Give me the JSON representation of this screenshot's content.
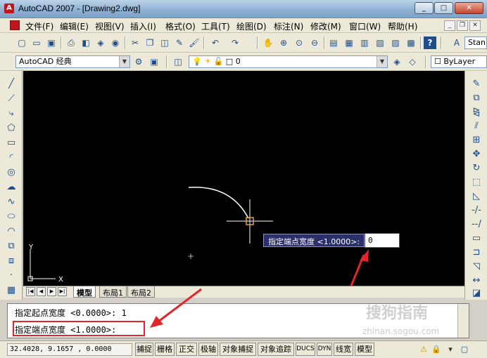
{
  "window": {
    "app_icon": "A",
    "title": "AutoCAD 2007 - [Drawing2.dwg]",
    "min": "_",
    "max": "□",
    "close": "✕"
  },
  "menu": {
    "items": [
      "文件(F)",
      "编辑(E)",
      "视图(V)",
      "插入(I)",
      "格式(O)",
      "工具(T)",
      "绘图(D)",
      "标注(N)",
      "修改(M)",
      "窗口(W)",
      "帮助(H)"
    ],
    "mdi_min": "_",
    "mdi_restore": "❐",
    "mdi_close": "✕"
  },
  "toolbar": {
    "workspace": "AutoCAD 经典",
    "layer": "0",
    "text_style": "Stan",
    "bylayer": "ByLayer"
  },
  "icons": {
    "toolbar1": [
      "new-icon",
      "open-icon",
      "save-icon",
      "print-icon",
      "preview-icon",
      "publish-icon",
      "3d-publish-icon",
      "cut-icon",
      "copy-icon",
      "paste-icon",
      "match-prop-icon",
      "brush-icon",
      "undo-icon",
      "redo-icon",
      "pan-icon",
      "zoom-realtime-icon",
      "zoom-window-icon",
      "zoom-previous-icon",
      "properties-icon",
      "design-center-icon",
      "tool-palette-icon",
      "sheet-set-icon",
      "markup-icon",
      "calculator-icon",
      "help-icon",
      "text-style-icon"
    ],
    "left": [
      "line-icon",
      "construction-line-icon",
      "polyline-icon",
      "polygon-icon",
      "rectangle-icon",
      "arc-icon",
      "circle-icon",
      "revision-cloud-icon",
      "spline-icon",
      "ellipse-icon",
      "ellipse-arc-icon",
      "insert-block-icon",
      "make-block-icon",
      "point-icon",
      "hatch-icon"
    ],
    "right": [
      "erase-icon",
      "copy-object-icon",
      "mirror-icon",
      "offset-icon",
      "array-icon",
      "move-icon",
      "rotate-icon",
      "scale-icon",
      "stretch-icon",
      "trim-icon",
      "extend-icon",
      "break-icon",
      "join-icon",
      "chamfer-icon",
      "fillet-icon",
      "explode-icon"
    ]
  },
  "drawing": {
    "axis_y": "Y",
    "axis_x": "X",
    "dyn_prompt": "指定端点宽度 <1.0000>:",
    "dyn_value": "0"
  },
  "tabs": {
    "nav": [
      "|◀",
      "◀",
      "▶",
      "▶|"
    ],
    "items": [
      "模型",
      "布局1",
      "布局2"
    ]
  },
  "command": {
    "line1": "指定起点宽度 <0.0000>: 1",
    "line2": "指定端点宽度 <1.0000>:"
  },
  "status": {
    "coords": "32.4028, 9.1657 , 0.0000",
    "buttons": [
      "捕捉",
      "栅格",
      "正交",
      "极轴",
      "对象捕捉",
      "对象追踪",
      "DUCS",
      "DYN",
      "线宽",
      "模型"
    ]
  },
  "watermark": {
    "main": "搜狗指南",
    "sub": "zhinan.sogou.com"
  },
  "colors": {
    "accent_red": "#e0252b",
    "canvas": "#000000",
    "prompt_bg": "#2b2f6a",
    "crosshair": "#ffffff",
    "snap_marker": "#e8a040"
  }
}
